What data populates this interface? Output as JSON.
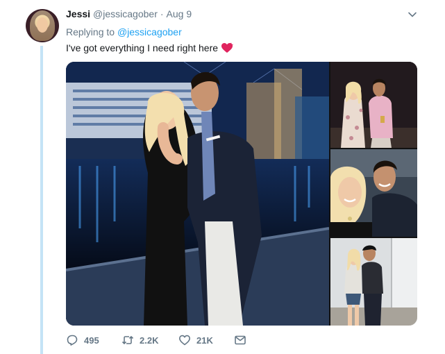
{
  "tweet": {
    "author_name": "Jessi",
    "author_handle": "@jessicagober",
    "separator": "·",
    "date": "Aug 9",
    "replying_prefix": "Replying to",
    "replying_to": "@jessicagober",
    "text": "I've got everything I need right here"
  },
  "actions": {
    "replies": "495",
    "retweets": "2.2K",
    "likes": "21K"
  },
  "icons": {
    "caret": "chevron-down-icon",
    "reply": "reply-icon",
    "retweet": "retweet-icon",
    "like": "heart-icon",
    "dm": "envelope-icon",
    "emoji": "heart-emoji"
  },
  "colors": {
    "link": "#1da1f2",
    "muted": "#657786",
    "thread_line": "#c4e3f6",
    "emoji_heart": "#e0245e"
  }
}
